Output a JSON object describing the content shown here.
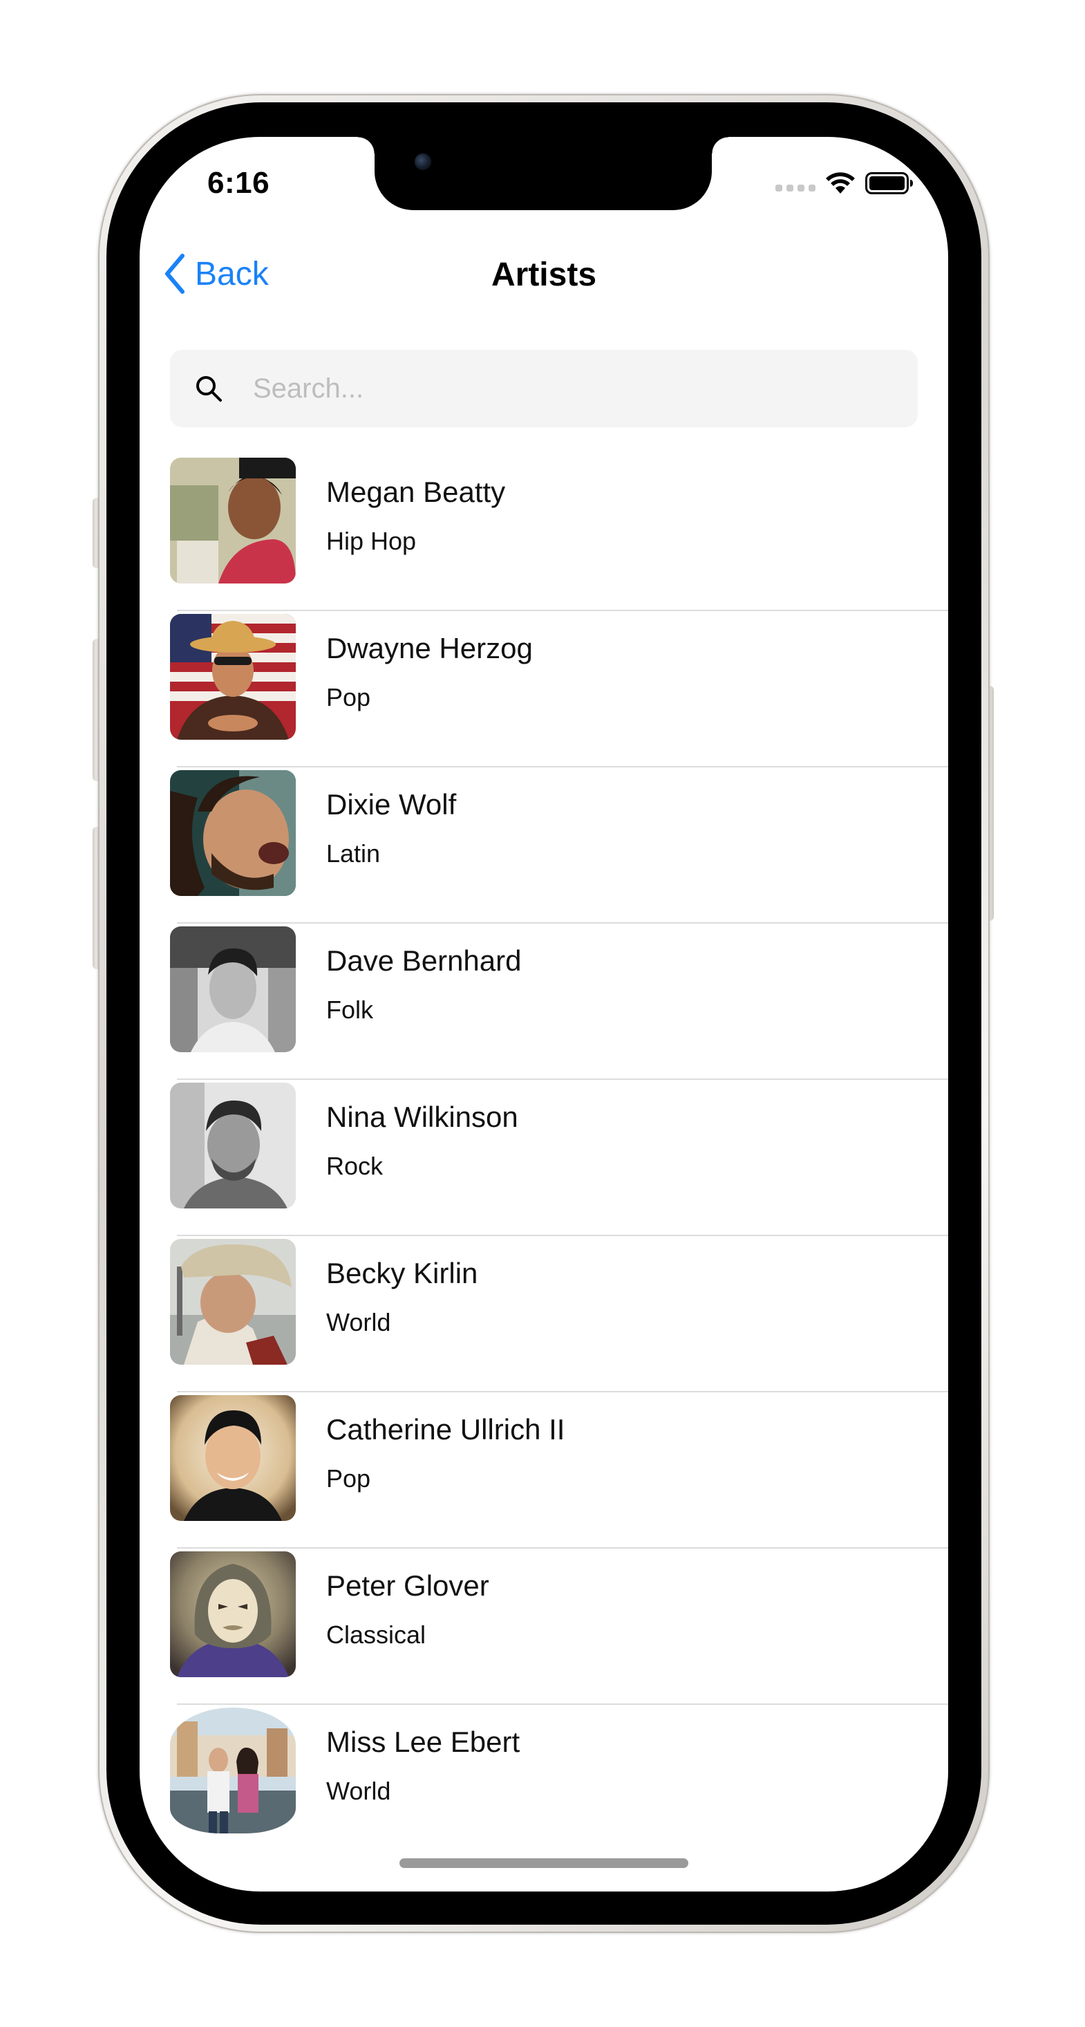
{
  "status_bar": {
    "time": "6:16"
  },
  "nav": {
    "back_label": "Back",
    "title": "Artists"
  },
  "search": {
    "placeholder": "Search...",
    "value": ""
  },
  "artists": [
    {
      "name": "Megan Beatty",
      "genre": "Hip Hop"
    },
    {
      "name": "Dwayne Herzog",
      "genre": "Pop"
    },
    {
      "name": "Dixie Wolf",
      "genre": "Latin"
    },
    {
      "name": "Dave Bernhard",
      "genre": "Folk"
    },
    {
      "name": "Nina Wilkinson",
      "genre": "Rock"
    },
    {
      "name": "Becky Kirlin",
      "genre": "World"
    },
    {
      "name": "Catherine Ullrich II",
      "genre": "Pop"
    },
    {
      "name": "Peter Glover",
      "genre": "Classical"
    },
    {
      "name": "Miss Lee Ebert",
      "genre": "World"
    }
  ],
  "colors": {
    "accent": "#1a82f7",
    "search_bg": "#f4f4f4",
    "divider": "#dcdcdc"
  }
}
